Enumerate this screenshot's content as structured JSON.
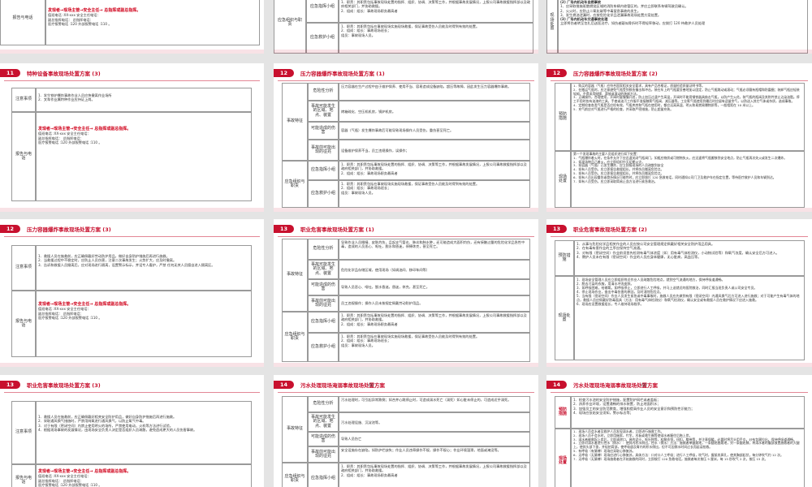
{
  "brand_color": "#c8102e",
  "slides": {
    "s_top1": {
      "label_report": "报告与电话",
      "red": "发现者→现场主管→安全主任→ 总指挥或副总指挥。",
      "body": "值班电话 :XX-xxx 安全主任电话：\n副总指挥电话： 总指挥电话：\n医疗报警电话 :120 外部报警电话 :110 。"
    },
    "s_top2": {
      "row1_label": "应急指挥小组",
      "row1_body": "1．职责：其职责包括事故现场处置的指挥、组织、协调、决策等工作，并根据事故发展情况，上报公司事故救援指挥部以及政府相关部门，并协助救援。\n2．组成：组长：事故现场职务最高者",
      "row2_label": "应急救护小组",
      "row2_body": "1．职责：其职责包括在事故现场实施现场救援，保证事故受伤人员能及时得到有效的处置。\n2．组成：组长：事故现场班长；\n组员：事故现场人员。",
      "side": "应急组织与职责"
    },
    "s_top3": {
      "label": "现场处置",
      "l1": "(2) 厂场内机动车自燃事故",
      "l2": "1、应采取措施驱散燃烧区域的消防车辆内收管区的，并应立即联系车辆驾驶员确认。\n2、火火时，应防止二氧化碳等中毒窒息事故的发生。\n3、发生燃油泄漏时，应按危险化学品泄漏事故现场处置方案处置。",
      "l3": "(3) 厂场内机动车交通事故处理",
      "l4": "立即将伤者转至包扎后送医治疗，如伤者疑似骨折时不得轻率移动，应拨打 120 待救护人员处理"
    },
    "s11": {
      "num": "11",
      "title": "特种设备事故现场处置方案 (3)",
      "notes_label": "注意事项",
      "notes": "1．发生铁炉爆炸事故作业人员应快撤离作业场所\n2．叉车作业属特种作业应持证上岗。",
      "report_label": "报告与电话",
      "red": "发现者→现场主管→安全主任→ 总指挥或副总指挥。",
      "body": "值班电话 :XX-xxx 安全主任电话：\n副总指挥电话： 总指挥电话：\n医疗报警电话 :120 外部报警电话 :110 。"
    },
    "s12a": {
      "num": "12",
      "title": "压力容器爆炸事故现场处置方案 (1)",
      "side1": "事故特征",
      "r1_label": "危险性分析",
      "r1": "压力容器在生产过程中由于维护保养、使用不当、容易造成设备缺陷，超压等故障，因此发生压力容器爆炸事故。",
      "r2_label": "事故可能发生的区域、地点、装置",
      "r2": "烤箱硫化、空压机机房，锅炉机房。",
      "r3_label": "可能造成的伤害",
      "r3": "容器（气瓶）发生爆炸事故后可能导致现场操作人员受伤，重伤甚至死亡。",
      "r4_label": "事故前可能出现的征兆",
      "r4": "设备维护保养不当，员工违规操作，误操作；",
      "side2": "应急组织与职责",
      "r5_label": "应急指挥小组",
      "r5": "1．职责：其职责包括事故现场处置的指挥、组织、协调、决策等工作，并根据事故发展情况，上报公司事故救援指挥部以及政府相关部门，并协助救援。\n2．组成：组长：事故现场职务最高者",
      "r6_label": "应急救护小组",
      "r6": "1．职责：其职责包括在事故现场实施现场救援，保证事故受伤人员能及时得到有效的处置。\n2．组成：组长：事故现场班长；\n组员：事故现场人员。"
    },
    "s12b": {
      "num": "12",
      "title": "压力容器爆炸事故现场处置方案 (2)",
      "side1": "预防措施",
      "prev": "1．购买的容器（气瓶）应符合国家相关安全要求，具有产品合格证，质量检验质量证明书等。\n2．在搬运气瓶时，应注意避免气瓶受到损伤撞击和冲击，装在车上的气瓶要妥善地加以固定，防止气瓶跳动或滚动；气瓶必须戴有瓶帽和防震圈；装卸气瓶应轻装轻卸，不得采用抛掷、滑放或滚动的装卸方法。\n3．正确操作，合理使用，开阀时要慢慢开启，防止加压过速产生高温，开阀时不能用钢铁器具敲击气瓶，以防产生火花，装气瓶的瓶阀及其附件禁止沾染油脂。停工不用时各有油漆的工具，手套或油污工作服不准接触氧气瓶阀、减压器等。工业氧气瓶使用到最后时应留有适量余气，以防送入其它气体或杂质，造成事故。\n4．定期检查各类气瓶是否应检有效，气瓶库房和气瓶在使用时，都应远离高温、明火和易燃易爆物质等，一般相距在 10 米以上。\n5．充气前应对气瓶进行严格的检查，并采取严密措施，防止超量充装。",
      "side2": "现场处置",
      "disp": "第一个发现事故的主要人员组织进行如下处置：\n1．气瓶爆炸着火时，在条件允许下应迅速关闭气瓶阀门，如瓶应物质或可燃物失火，应迅速将气瓶搬移到安全地点，防止气瓶再次失火或发生二次爆炸。\n2．如现场物品已着火，应立即组织扑灭初期火灾。\n3．如容器（气瓶）已发生爆炸，应立即报现场的人员疏散到安全\n4．如有人员受伤，应立即报告救援组长，并将伤员搬离危险点。\n5．如有人员受伤，应立即报告救援组长，并将伤员搬离危险点。\n6．如有人员出现重伤或骨折情况可能性时，应立即拨打 120 急救电话，同时通知公司门卫及救护车在指定位置，等待医疗救护人员和车辆到达。\n7．如有人员受伤，应立即采取简易止血方法进行紧急救治。"
    },
    "s12c": {
      "num": "12",
      "title": "压力容器爆炸事故现场处置方案 (3)",
      "notes_label": "注意事项",
      "notes": "1．救援人员在施救前，应正确佩戴好劳动防护用品，做好自身防护措施后再进行施救。\n2．当救援过程中不稳定时，应防止人员伤害，注意二次事故发生；火势扩大，应及时撤离。\n3．告诉和救援人员撤离后，应对现场进行隔离，设置警示标示，并设专人看护，严禁 任何无关人员擅自进入隔离区。",
      "report_label": "报告与电话",
      "red": "发现者→现场主管→安全主任→ 总指挥或副总指挥。",
      "body": "值班电话 :XX-xxx 安全主任电话：\n副总指挥电话： 总指挥电话：\n医疗报警电话 :120 外部报警电话 :110 。"
    },
    "s13a": {
      "num": "13",
      "title": "职业危害事故现场处置方案 (1)",
      "side1": "事故特征",
      "r1_label": "危险性分析",
      "r1": "导致作业人员眼睛、皮肤灼伤，且起支气管炎、肺炎和肺水肿，还可能造成大面积灼伤，还有接触过量的危险化学品急性中毒，造成的人员恶心、呕吐，脱水和昏迷，停搏休克，甚至死亡。",
      "r2_label": "事故可能发生的区域、地点、装置",
      "r2": "危险化学品存储区域，使用现场（如调油间、移印车间等）",
      "r3_label": "可能造成的伤害",
      "r3": "导致人员恶心、呕吐，脱水昏迷，昏迷，休克，甚至死亡。",
      "r4_label": "事故前可能出现的征兆",
      "r4": "员工违规操作；操作人员未按规定佩戴劳动防护用品。",
      "side2": "应急组织与职责",
      "r5_label": "应急指挥小组",
      "r5": "1．职责：其职责包括事故现场处置的指挥、组织、协调、决策等工作，并根据事故发展情况，上报公司事故救援指挥部以及政府相关部门，并协助救援。\n2．组成：组长：事故现场职务最高者",
      "r6_label": "应急救护小组",
      "r6": "1．职责：其职责包括在事故现场实施现场救援，保证事故受伤人员能及时得到有效的处置。\n2．组成：组长：事故现场班长；\n组员：事故现场人员。"
    },
    "s13b": {
      "num": "13",
      "title": "职业危害事故现场处置方案 (2)",
      "side1": "预防措施",
      "prev": "1．从事与危险化学品相关作业的人员应按公司安全管理规定佩戴好相关安全防护用品用具。\n2．在有毒有害作业的工序应保持空气流通。\n3．对有限（密闭空间）作业前须首先检测有毒气体浓度（如：用有毒气体检测仪，小动物试验等）和氧气浓度，确认安全后方可进入。\n4．教护人员未在有限（密闭空间）作业的人员应身体健康，无心脏病，高血压等。",
      "side2": "现场处置",
      "disp": "1．现场安全管理人员应立即组织附近作业人员疏散危险地点，就到空气流通的地方，保持呼吸道通畅。\n2．脱去污染的衣服，用清水冲洗皮肤。\n3．如呼吸困难，给输氧。如呼吸停止，立即进行人工呼吸，并马上送就近的医院救治，同时汇报当班负责人或公司安全专员。\n4．停止现场作业，查出中毒伤害的原因，及时消除危险点。\n5．当有限（密闭空间）作业人员发生紧急或中毒事故时，施救人员应先做到有限（密闭空间）内通风换气后方可进入进行施救；对于可能产生有毒气体的地点，救援人员应佩戴好防毒面具（方法：用有毒气体检测仪）和氧气检测仪，确认安全或有救援人员在救护情况下应进入施救。\n6．现场应设置救援组长，专人维持现场秩序。"
    },
    "s13c": {
      "num": "13",
      "title": "职业危害事故现场处置方案 (3)",
      "notes_label": "注意事项",
      "notes": "1．救援人员在施救前，应正确佩戴好相关安全防护用品，做好自身防护措施后再进行施救。\n2．采取通风换气措施时，严禁用纯氧进行通风换气，以防止氧气中毒。\n3．对于有限（密闭空间）内禁止使用明火的场所，严禁使用电动，火机等方法进行试验。\n4．根据现场事故的发展情况，由现场安全负责人决定是否组织人员疏散，避免造成更大的人员伤害事故。",
      "report_label": "报告与电话",
      "red": "发现者→现场主管→安全主任→ 总指挥或副总指挥。",
      "body": "值班电话 :XX-xxx 安全主任电话：\n副总指挥电话： 总指挥电话：\n医疗报警电话 :120 外部报警电话 :110 。"
    },
    "s14a": {
      "num": "14",
      "title": "污水处理现场淹溺事故现场处置方案",
      "subtitle": "(1)",
      "side1": "事故特征",
      "r1_label": "危险性分析",
      "r1": "污水处理时，可引起异常跌倒；如合并心跳停止时，可造成溺水死亡（溺死）如心脏未停止的，可造成近乎溺死。",
      "r2_label": "事故可能发生的区域、地点、装置",
      "r2": "污水处理设施、沉淀池等。",
      "r3_label": "可能造成的伤害",
      "r3": "导致人员伤亡",
      "r4_label": "事故前可能出现的征兆",
      "r4": "安全设施存在缺陷，如防护栏缺失；作业人员违章操作不规，操作不规心；作业环境湿滑，地面或淹没等。",
      "side2": "应急组织与职责",
      "r5_label": "应急指挥小组",
      "r5": "1．职责：其职责包括事故现场处置的指挥、组织、协调、决策等工作，并根据事故发展情况，上报公司事故救援指挥部以及政府相关部门，并协助救援。\n2．组成：组长：事故现场职务最高者"
    },
    "s14b": {
      "num": "14",
      "title": "污水处理现场淹溺事故现场处置方案",
      "subtitle": "(2)",
      "side1": "预防措施",
      "prev": "1．检查污水池的安全防护措施，配置防护网栏或者盖板；\n2．孩养作业环境，设置通畅的排水装置，防止地面积水；\n3．加强员工的安全防范教育，增强和提高作业人员的安全意识和预防性识能力；\n4．现场应张贴安全须知，警示标志等；",
      "side2": "现场处置",
      "disp": "1．现场人员会水者及救护人员发现溺水者，立即进行施救工作。\n2．现场人员不会水时，立即用绳索，竹竿，木板或救生圈等使溺水者握住后拖上岸。\n3．溺水者被救起上岸后，立即清除口，鼻的泥沙，呕吐物等，松解衣领，纽扣，腰带等，并注意保暖，必要时将舌头用手巾，纱布包裹拉出，保持呼吸道通畅。\n4．立即对溺水者进行控水（倒水）：使其内积水倒出，控水（倒水）方法：施救者单腿跪地，一条腿屈曲跪地，另一条腿屈膝，将溺水者的腹部放置施救者的大腿上，使其头部下垂，并轻拍背部，使呼吸道及胃内的积水倒出，但不可因倒水时间过长而延误抢救。\n5．有呼吸（有脉搏）现场应采取心肺复苏。\n6．无呼吸（无脉搏）现场应进行心肺复苏，具体方法：口对口人工呼吸；进行人工呼吸，吹气时，握紧其鼻孔，使其胸部起伏，每分钟吹气约 12 次。\n7．无呼吸（无脉搏）现场施救者在开始施救的同时，立即拨打 120 急救电话，施救者每次按压 5 厘米，每 15 秒吹气 2 次，按压 15 次。"
    }
  }
}
